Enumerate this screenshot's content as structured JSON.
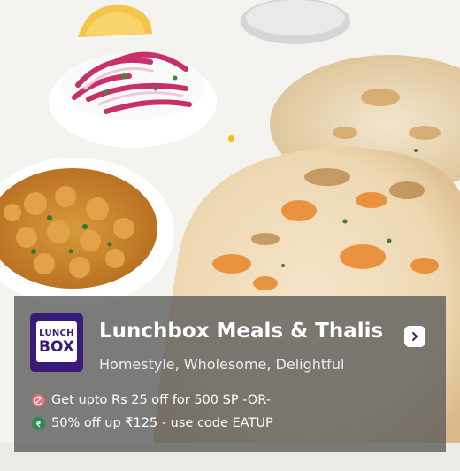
{
  "restaurant": {
    "logo_line1": "LUNCH",
    "logo_line2": "BOX",
    "name": "Lunchbox Meals & Thalis",
    "tagline": "Homestyle, Wholesome, Delightful"
  },
  "offers": [
    {
      "icon": "offer-percent-icon",
      "text": "Get upto Rs 25 off for 500 SP   -OR-"
    },
    {
      "icon": "rupee-discount-icon",
      "text": "50% off up ₹125 - use code EATUP"
    }
  ],
  "colors": {
    "panel_overlay": "#5c5c5c",
    "logo_purple": "#3a1a78",
    "offer_icon_red": "#e86a70",
    "offer_icon_green": "#2c8a52",
    "carousel_dot": "#f2c200"
  }
}
